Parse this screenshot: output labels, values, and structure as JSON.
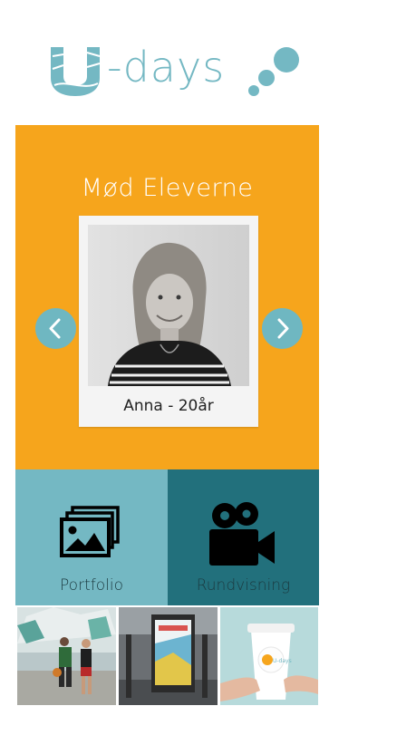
{
  "brand": {
    "logo_text": "-days",
    "logo_letter": "U"
  },
  "colors": {
    "accent_orange": "#f6a51c",
    "teal_light": "#74b8c3",
    "teal_dark": "#22707c",
    "white": "#ffffff"
  },
  "carousel": {
    "title": "Mød Eleverne",
    "caption": "Anna - 20år",
    "prev_icon": "chevron-left-icon",
    "next_icon": "chevron-right-icon"
  },
  "tiles": [
    {
      "label": "Portfolio",
      "icon": "gallery-icon"
    },
    {
      "label": "Rundvisning",
      "icon": "video-camera-icon"
    }
  ],
  "gallery": [
    {
      "subject": "basketball players"
    },
    {
      "subject": "bus stop poster"
    },
    {
      "subject": "coffee cup with logo",
      "cup_text": "U-days"
    }
  ]
}
